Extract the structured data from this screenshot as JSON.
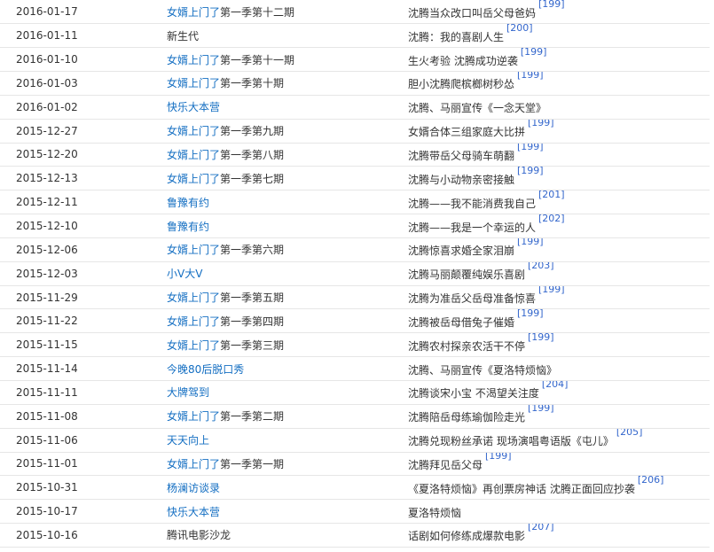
{
  "table": {
    "rows": [
      {
        "date": "2016-01-17",
        "show_link": "女婿上门了",
        "show_text": "第一季第十二期",
        "desc": "沈腾当众改口叫岳父母爸妈",
        "cite": "[199]"
      },
      {
        "date": "2016-01-11",
        "show_link": "",
        "show_text": "新生代",
        "desc": "沈腾：我的喜剧人生",
        "cite": "[200]"
      },
      {
        "date": "2016-01-10",
        "show_link": "女婿上门了",
        "show_text": "第一季第十一期",
        "desc": "生火考验 沈腾成功逆袭",
        "cite": "[199]"
      },
      {
        "date": "2016-01-03",
        "show_link": "女婿上门了",
        "show_text": "第一季第十期",
        "desc": "胆小沈腾爬槟榔树秒怂",
        "cite": "[199]"
      },
      {
        "date": "2016-01-02",
        "show_link": "快乐大本营",
        "show_text": "",
        "desc": "沈腾、马丽宣传《一念天堂》",
        "cite": ""
      },
      {
        "date": "2015-12-27",
        "show_link": "女婿上门了",
        "show_text": "第一季第九期",
        "desc": "女婿合体三组家庭大比拼",
        "cite": "[199]"
      },
      {
        "date": "2015-12-20",
        "show_link": "女婿上门了",
        "show_text": "第一季第八期",
        "desc": "沈腾带岳父母骑车萌翻",
        "cite": "[199]"
      },
      {
        "date": "2015-12-13",
        "show_link": "女婿上门了",
        "show_text": "第一季第七期",
        "desc": "沈腾与小动物亲密接触",
        "cite": "[199]"
      },
      {
        "date": "2015-12-11",
        "show_link": "鲁豫有约",
        "show_text": "",
        "desc": "沈腾——我不能消费我自己",
        "cite": "[201]"
      },
      {
        "date": "2015-12-10",
        "show_link": "鲁豫有约",
        "show_text": "",
        "desc": "沈腾——我是一个幸运的人",
        "cite": "[202]"
      },
      {
        "date": "2015-12-06",
        "show_link": "女婿上门了",
        "show_text": "第一季第六期",
        "desc": "沈腾惊喜求婚全家泪崩",
        "cite": "[199]"
      },
      {
        "date": "2015-12-03",
        "show_link": "小V大V",
        "show_text": "",
        "desc": "沈腾马丽颠覆纯娱乐喜剧",
        "cite": "[203]"
      },
      {
        "date": "2015-11-29",
        "show_link": "女婿上门了",
        "show_text": "第一季第五期",
        "desc": "沈腾为准岳父岳母准备惊喜",
        "cite": "[199]"
      },
      {
        "date": "2015-11-22",
        "show_link": "女婿上门了",
        "show_text": "第一季第四期",
        "desc": "沈腾被岳母借兔子催婚",
        "cite": "[199]"
      },
      {
        "date": "2015-11-15",
        "show_link": "女婿上门了",
        "show_text": "第一季第三期",
        "desc": "沈腾农村探亲农活干不停",
        "cite": "[199]"
      },
      {
        "date": "2015-11-14",
        "show_link": "今晚80后脱口秀",
        "show_text": "",
        "desc": "沈腾、马丽宣传《夏洛特烦恼》",
        "cite": ""
      },
      {
        "date": "2015-11-11",
        "show_link": "大牌驾到",
        "show_text": "",
        "desc": "沈腾谈宋小宝 不渴望关注度",
        "cite": "[204]"
      },
      {
        "date": "2015-11-08",
        "show_link": "女婿上门了",
        "show_text": "第一季第二期",
        "desc": "沈腾陪岳母练瑜伽险走光",
        "cite": "[199]"
      },
      {
        "date": "2015-11-06",
        "show_link": "天天向上",
        "show_text": "",
        "desc": "沈腾兑现粉丝承诺 现场演唱粤语版《屯儿》",
        "cite": "[205]"
      },
      {
        "date": "2015-11-01",
        "show_link": "女婿上门了",
        "show_text": "第一季第一期",
        "desc": "沈腾拜见岳父母",
        "cite": "[199]"
      },
      {
        "date": "2015-10-31",
        "show_link": "杨澜访谈录",
        "show_text": "",
        "desc": "《夏洛特烦恼》再创票房神话 沈腾正面回应抄袭",
        "cite": "[206]"
      },
      {
        "date": "2015-10-17",
        "show_link": "快乐大本营",
        "show_text": "",
        "desc": "夏洛特烦恼",
        "cite": ""
      },
      {
        "date": "2015-10-16",
        "show_link": "",
        "show_text": "腾讯电影沙龙",
        "desc": "话剧如何修练成爆款电影",
        "cite": "[207]"
      }
    ]
  }
}
